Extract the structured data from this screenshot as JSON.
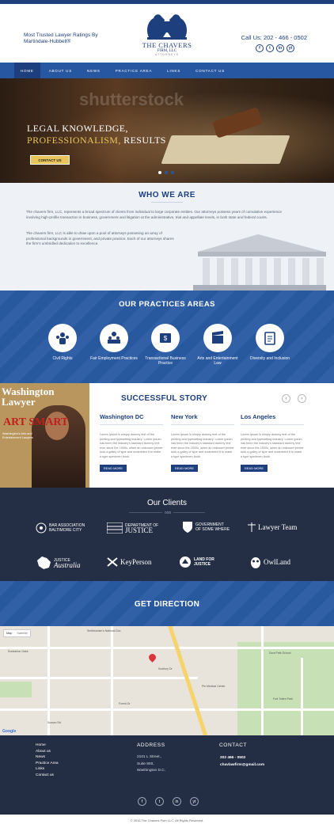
{
  "header": {
    "tagline": "Most Trusted Lawyer Ratings By Martindale-Hubbell®",
    "logo_title": "THE CHAVERS",
    "logo_sub": "FIRM, LLC",
    "logo_small": "ATTORNEYS",
    "callus": "Call Us: 202 - 466 - 0502",
    "social": [
      "f",
      "t",
      "in",
      "yt"
    ]
  },
  "nav": {
    "items": [
      "HOME",
      "ABOUT US",
      "NEWS",
      "PRACTICE AREA",
      "LINKS",
      "CONTACT US"
    ]
  },
  "hero": {
    "watermark": "shutterstock",
    "line1": "LEGAL KNOWLEDGE,",
    "line2_gold": "PROFESSIONALISM,",
    "line2_rest": " RESULTS",
    "cta": "CONTACT US",
    "slides_total": 3,
    "active_slide": 2
  },
  "who": {
    "title": "WHO WE ARE",
    "p1": "The chavers firm, LLC, represents a broad spectrum of clients from individual to large corporate entities. Our attorneys possess years of cumulative experience involving high-profile transaction in business, government and litigation at the administrative, trial and appellate levels, in both state and federal courts.",
    "p2": "The chavers firm, LLC is able to draw upon a pool of attorneys possesing an array of professional backgrounds in government, and private practice. Each of our attorneys shares the firm's umbridled dedication to excellence."
  },
  "practices": {
    "title": "OUR PRACTICES AREAS",
    "items": [
      {
        "label": "Civil Rights",
        "icon": "civil-rights-icon"
      },
      {
        "label": "Fair Employment Practices",
        "icon": "employment-icon"
      },
      {
        "label": "Transactional Business Practice",
        "icon": "business-icon"
      },
      {
        "label": "Arts and Entertainment Law",
        "icon": "entertainment-icon"
      },
      {
        "label": "Diversity and Inclusion",
        "icon": "diversity-icon"
      }
    ]
  },
  "story": {
    "magazine_title": "Washington Lawyer",
    "magazine_art": "ART SMART",
    "magazine_caption": "Washington's Arts and Entertainment Lawyers",
    "title": "SUCCESSFUL STORY",
    "prev": "‹",
    "next": "›",
    "cities": [
      {
        "name": "Washington DC",
        "text": "Lorem Ipsum is simply dummy text of the printing and typesetting industry. Lorem Ipsum has been the industry's standard dummy text ever since the 1500s, when an unknown printer took a galley of type and scrambled it to make a type specimen book.",
        "btn": "READ MORE"
      },
      {
        "name": "New York",
        "text": "Lorem Ipsum is simply dummy text of the printing and typesetting industry. Lorem Ipsum has been the industry's standard dummy text ever since the 1500s, when an unknown printer took a galley of type and scrambled it to make a type specimen book.",
        "btn": "READ MORE"
      },
      {
        "name": "Los Angeles",
        "text": "Lorem Ipsum is simply dummy text of the printing and typesetting industry. Lorem Ipsum has been the industry's standard dummy text ever since the 1500s, when an unknown printer took a galley of type and scrambled it to make a type specimen book.",
        "btn": "READ MORE"
      }
    ]
  },
  "clients": {
    "title": "Our Clients",
    "logos": [
      {
        "name": "BAR ASSOCIATION",
        "sub": "BALTIMORE CITY"
      },
      {
        "name": "JUSTICE",
        "sub": "DEPARTMENT OF"
      },
      {
        "name": "GOVERNMENT",
        "sub": "OF SOME WHERE"
      },
      {
        "name": "Lawyer Team",
        "sub": ""
      },
      {
        "name": "JUSTICE",
        "sub": "Australia"
      },
      {
        "name": "KeyPerson",
        "sub": ""
      },
      {
        "name": "LAND FOR",
        "sub": "JUSTICE"
      },
      {
        "name": "OwlLand",
        "sub": ""
      }
    ]
  },
  "direction": {
    "title": "GET DIRECTION"
  },
  "map": {
    "controls": [
      "Map",
      "Satellite"
    ],
    "labels": [
      "Smithsonian's National Zoo",
      "Dunbarton Oaks",
      "Sunbury Dr",
      "Forest Dr",
      "Dora Park School",
      "Sussex Rd",
      "Fort Totten Park",
      "Pin Medical Center",
      "Google"
    ],
    "pin_color": "#d9363e"
  },
  "footer": {
    "links": [
      "Home",
      "About us",
      "News",
      "Practice Area",
      "Links",
      "Contact us"
    ],
    "address_title": "ADDRESS",
    "address_lines": [
      "2101 L Street.,",
      "Suite 800,",
      "Washington D.C."
    ],
    "contact_title": "CONTACT",
    "phone": "202 466 - 0502",
    "email": "chavlawfirm@gmail.com",
    "social": [
      "f",
      "t",
      "in",
      "yt"
    ],
    "copyright": "© 2016 The Chavers Firm LLC. All Rights Reserved."
  },
  "colors": {
    "primary": "#1d3f7e",
    "accent": "#2857a1",
    "gold": "#e8c55a",
    "dark": "#242e44"
  }
}
